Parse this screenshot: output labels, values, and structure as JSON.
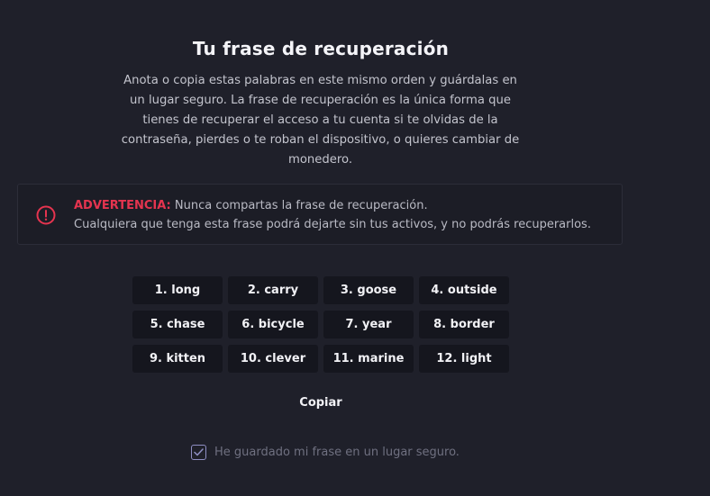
{
  "header": {
    "title": "Tu frase de recuperación",
    "description": "Anota o copia estas palabras en este mismo orden y guárdalas en un lugar seguro. La frase de recuperación es la única forma que tienes de recuperar el acceso a tu cuenta si te olvidas de la contraseña, pierdes o te roban el dispositivo, o quieres cambiar de monedero."
  },
  "warning": {
    "icon": "alert-circle-icon",
    "label": "ADVERTENCIA:",
    "line1": "Nunca compartas la frase de recuperación.",
    "line2": "Cualquiera que tenga esta frase podrá dejarte sin tus activos, y no podrás recuperarlos.",
    "color": "#e5344f"
  },
  "words": [
    "1. long",
    "2. carry",
    "3. goose",
    "4. outside",
    "5. chase",
    "6. bicycle",
    "7. year",
    "8. border",
    "9. kitten",
    "10. clever",
    "11. marine",
    "12. light"
  ],
  "actions": {
    "copy_label": "Copiar"
  },
  "confirm": {
    "label": "He guardado mi frase en un lugar seguro.",
    "checked": true
  }
}
